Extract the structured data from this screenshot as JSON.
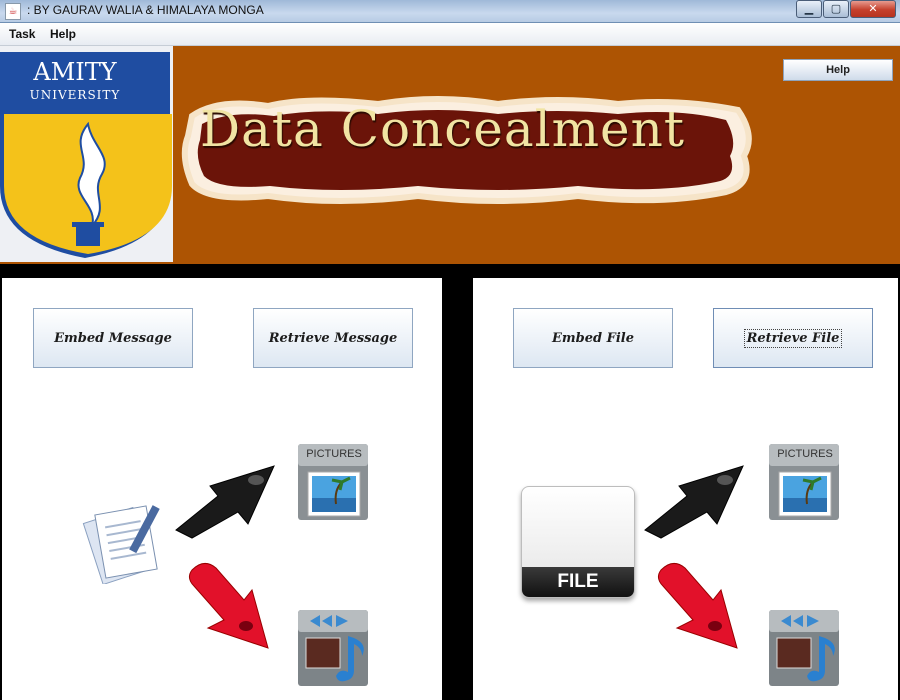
{
  "window": {
    "title": ": BY GAURAV WALIA & HIMALAYA MONGA"
  },
  "menu": [
    "Task",
    "Help"
  ],
  "banner": {
    "logo_line1": "AMITY",
    "logo_line2": "UNIVERSITY",
    "heading": "Data Concealment",
    "help_label": "Help"
  },
  "left_panel": {
    "embed_label": "Embed Message",
    "retrieve_label": "Retrieve Message",
    "pictures_label": "PICTURES"
  },
  "right_panel": {
    "embed_label": "Embed File",
    "retrieve_label": "Retrieve File",
    "file_label": "FILE",
    "pictures_label": "PICTURES"
  },
  "colors": {
    "banner": "#ad5403",
    "logo_blue": "#1f4da1",
    "logo_yellow": "#f4c21a"
  }
}
